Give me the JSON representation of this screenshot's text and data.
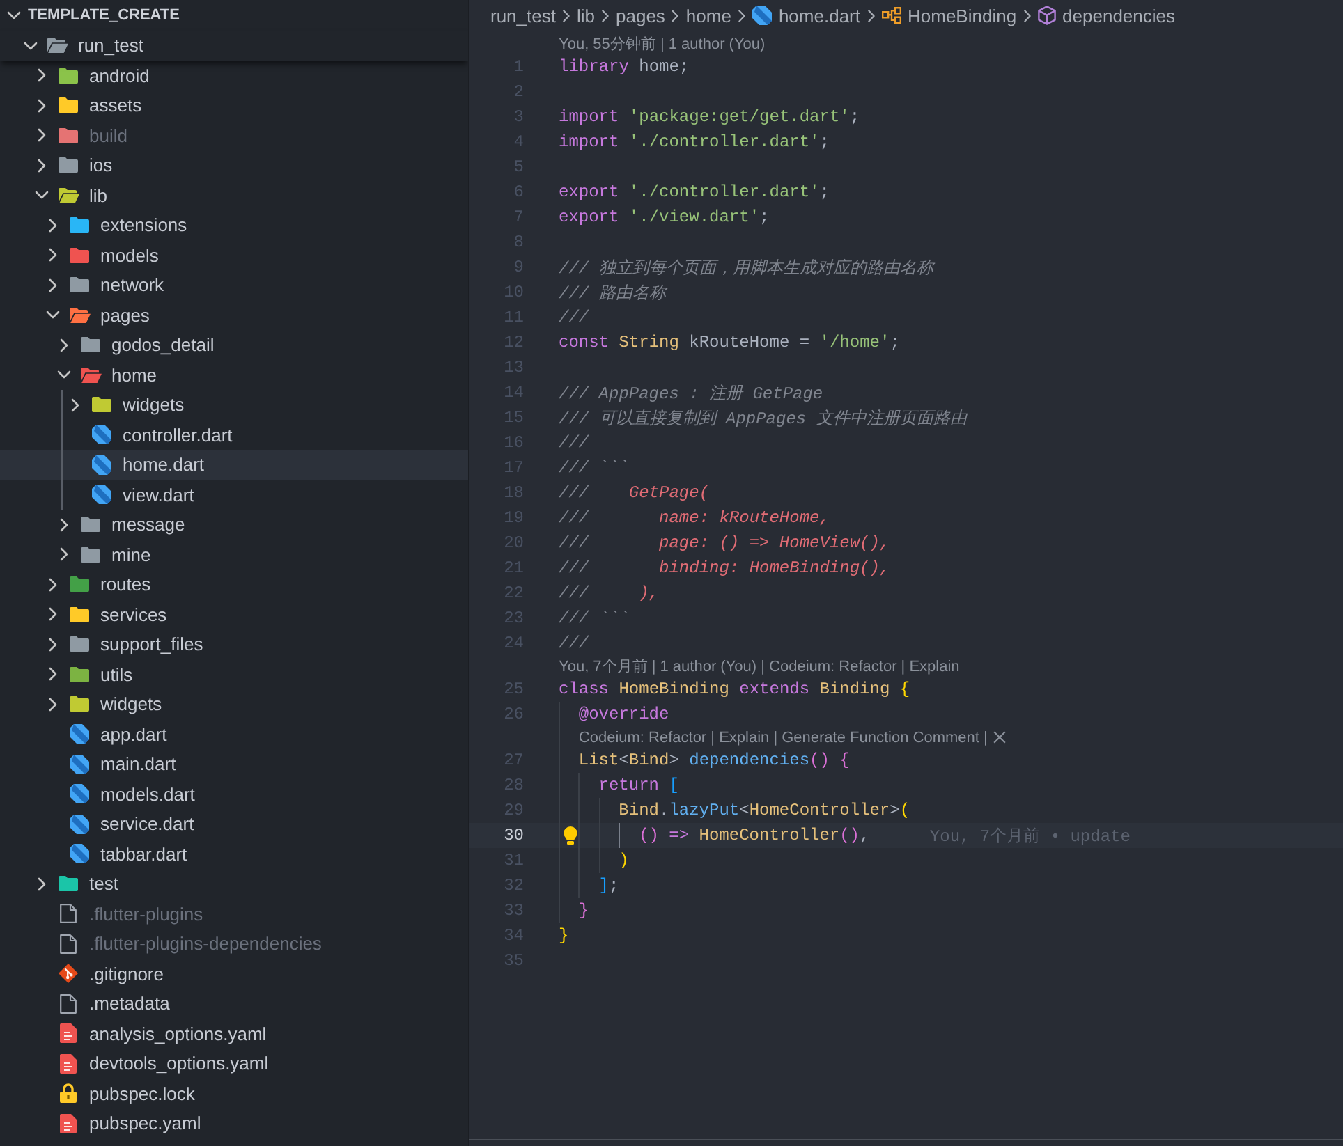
{
  "explorer": {
    "header": {
      "label": "TEMPLATE_CREATE",
      "expanded": true
    },
    "tree": [
      {
        "label": "run_test",
        "kind": "folder",
        "color": "#8f9aa3",
        "expanded": true,
        "selected": false,
        "ignored": false,
        "children": [
          {
            "label": "android",
            "kind": "folder",
            "color": "#8bc34a",
            "expanded": false,
            "selected": false,
            "ignored": false
          },
          {
            "label": "assets",
            "kind": "folder",
            "color": "#ffca28",
            "expanded": false,
            "selected": false,
            "ignored": false
          },
          {
            "label": "build",
            "kind": "folder",
            "color": "#e57373",
            "expanded": false,
            "selected": false,
            "ignored": true
          },
          {
            "label": "ios",
            "kind": "folder",
            "color": "#8f9aa3",
            "expanded": false,
            "selected": false,
            "ignored": false
          },
          {
            "label": "lib",
            "kind": "folder",
            "color": "#c0ca33",
            "expanded": true,
            "selected": false,
            "ignored": false,
            "children": [
              {
                "label": "extensions",
                "kind": "folder",
                "color": "#29b6f6",
                "expanded": false,
                "selected": false,
                "ignored": false
              },
              {
                "label": "models",
                "kind": "folder",
                "color": "#ef5350",
                "expanded": false,
                "selected": false,
                "ignored": false
              },
              {
                "label": "network",
                "kind": "folder",
                "color": "#8f9aa3",
                "expanded": false,
                "selected": false,
                "ignored": false
              },
              {
                "label": "pages",
                "kind": "folder",
                "color": "#ff7043",
                "expanded": true,
                "selected": false,
                "ignored": false,
                "children": [
                  {
                    "label": "godos_detail",
                    "kind": "folder",
                    "color": "#8f9aa3",
                    "expanded": false,
                    "selected": false,
                    "ignored": false
                  },
                  {
                    "label": "home",
                    "kind": "folder",
                    "color": "#ef5350",
                    "expanded": true,
                    "selected": false,
                    "ignored": false,
                    "children": [
                      {
                        "label": "widgets",
                        "kind": "folder",
                        "color": "#c0ca33",
                        "expanded": false,
                        "selected": false,
                        "ignored": false
                      },
                      {
                        "label": "controller.dart",
                        "kind": "dart",
                        "selected": false,
                        "ignored": false
                      },
                      {
                        "label": "home.dart",
                        "kind": "dart",
                        "selected": true,
                        "ignored": false
                      },
                      {
                        "label": "view.dart",
                        "kind": "dart",
                        "selected": false,
                        "ignored": false
                      }
                    ]
                  },
                  {
                    "label": "message",
                    "kind": "folder",
                    "color": "#8f9aa3",
                    "expanded": false,
                    "selected": false,
                    "ignored": false
                  },
                  {
                    "label": "mine",
                    "kind": "folder",
                    "color": "#8f9aa3",
                    "expanded": false,
                    "selected": false,
                    "ignored": false
                  }
                ]
              },
              {
                "label": "routes",
                "kind": "folder",
                "color": "#43a047",
                "expanded": false,
                "selected": false,
                "ignored": false
              },
              {
                "label": "services",
                "kind": "folder",
                "color": "#ffca28",
                "expanded": false,
                "selected": false,
                "ignored": false
              },
              {
                "label": "support_files",
                "kind": "folder",
                "color": "#8f9aa3",
                "expanded": false,
                "selected": false,
                "ignored": false
              },
              {
                "label": "utils",
                "kind": "folder",
                "color": "#7cb342",
                "expanded": false,
                "selected": false,
                "ignored": false
              },
              {
                "label": "widgets",
                "kind": "folder",
                "color": "#c0ca33",
                "expanded": false,
                "selected": false,
                "ignored": false
              },
              {
                "label": "app.dart",
                "kind": "dart",
                "selected": false,
                "ignored": false
              },
              {
                "label": "main.dart",
                "kind": "dart",
                "selected": false,
                "ignored": false
              },
              {
                "label": "models.dart",
                "kind": "dart",
                "selected": false,
                "ignored": false
              },
              {
                "label": "service.dart",
                "kind": "dart",
                "selected": false,
                "ignored": false
              },
              {
                "label": "tabbar.dart",
                "kind": "dart",
                "selected": false,
                "ignored": false
              }
            ]
          },
          {
            "label": "test",
            "kind": "folder",
            "color": "#1bc5a8",
            "expanded": false,
            "selected": false,
            "ignored": false
          },
          {
            "label": ".flutter-plugins",
            "kind": "plain",
            "selected": false,
            "ignored": true
          },
          {
            "label": ".flutter-plugins-dependencies",
            "kind": "plain",
            "selected": false,
            "ignored": true
          },
          {
            "label": ".gitignore",
            "kind": "git",
            "selected": false,
            "ignored": false
          },
          {
            "label": ".metadata",
            "kind": "plain",
            "selected": false,
            "ignored": false
          },
          {
            "label": "analysis_options.yaml",
            "kind": "yaml",
            "selected": false,
            "ignored": false
          },
          {
            "label": "devtools_options.yaml",
            "kind": "yaml",
            "selected": false,
            "ignored": false
          },
          {
            "label": "pubspec.lock",
            "kind": "lock",
            "selected": false,
            "ignored": false
          },
          {
            "label": "pubspec.yaml",
            "kind": "yaml",
            "selected": false,
            "ignored": false
          }
        ]
      }
    ]
  },
  "editor": {
    "breadcrumbs": [
      {
        "label": "run_test",
        "kind": "folder"
      },
      {
        "label": "lib",
        "kind": "folder"
      },
      {
        "label": "pages",
        "kind": "folder"
      },
      {
        "label": "home",
        "kind": "folder"
      },
      {
        "label": "home.dart",
        "kind": "dart"
      },
      {
        "label": "HomeBinding",
        "kind": "class"
      },
      {
        "label": "dependencies",
        "kind": "method"
      }
    ],
    "lines": [
      {
        "number": "1",
        "current": false,
        "codelens": {
          "text": "You, 55分钟前 | 1 author (You)",
          "closable": false
        },
        "tokens": [
          {
            "kind": "keyword",
            "text": "library"
          },
          {
            "kind": "plain",
            "text": " home;"
          }
        ]
      },
      {
        "number": "2",
        "current": false
      },
      {
        "number": "3",
        "current": false,
        "tokens": [
          {
            "kind": "keyword",
            "text": "import "
          },
          {
            "kind": "string",
            "text": "'package:get/get.dart'"
          },
          {
            "kind": "plain",
            "text": ";"
          }
        ]
      },
      {
        "number": "4",
        "current": false,
        "tokens": [
          {
            "kind": "keyword",
            "text": "import "
          },
          {
            "kind": "string",
            "text": "'./controller.dart'"
          },
          {
            "kind": "plain",
            "text": ";"
          }
        ]
      },
      {
        "number": "5",
        "current": false
      },
      {
        "number": "6",
        "current": false,
        "tokens": [
          {
            "kind": "keyword",
            "text": "export "
          },
          {
            "kind": "string",
            "text": "'./controller.dart'"
          },
          {
            "kind": "plain",
            "text": ";"
          }
        ]
      },
      {
        "number": "7",
        "current": false,
        "tokens": [
          {
            "kind": "keyword",
            "text": "export "
          },
          {
            "kind": "string",
            "text": "'./view.dart'"
          },
          {
            "kind": "plain",
            "text": ";"
          }
        ]
      },
      {
        "number": "8",
        "current": false
      },
      {
        "number": "9",
        "current": false,
        "tokens": [
          {
            "kind": "comment",
            "text": "/// 独立到每个页面，用脚本生成对应的路由名称"
          }
        ]
      },
      {
        "number": "10",
        "current": false,
        "tokens": [
          {
            "kind": "comment",
            "text": "/// 路由名称"
          }
        ]
      },
      {
        "number": "11",
        "current": false,
        "tokens": [
          {
            "kind": "comment",
            "text": "///"
          }
        ]
      },
      {
        "number": "12",
        "current": false,
        "tokens": [
          {
            "kind": "keyword",
            "text": "const "
          },
          {
            "kind": "type",
            "text": "String"
          },
          {
            "kind": "plain",
            "text": " kRouteHome = "
          },
          {
            "kind": "string",
            "text": "'/home'"
          },
          {
            "kind": "plain",
            "text": ";"
          }
        ]
      },
      {
        "number": "13",
        "current": false
      },
      {
        "number": "14",
        "current": false,
        "tokens": [
          {
            "kind": "comment",
            "text": "/// AppPages : 注册 GetPage"
          }
        ]
      },
      {
        "number": "15",
        "current": false,
        "tokens": [
          {
            "kind": "comment",
            "text": "/// 可以直接复制到 AppPages 文件中注册页面路由"
          }
        ]
      },
      {
        "number": "16",
        "current": false,
        "tokens": [
          {
            "kind": "comment",
            "text": "///"
          }
        ]
      },
      {
        "number": "17",
        "current": false,
        "tokens": [
          {
            "kind": "comment",
            "text": "/// ```"
          }
        ]
      },
      {
        "number": "18",
        "current": false,
        "tokens": [
          {
            "kind": "comment",
            "text": "///    "
          },
          {
            "kind": "doc-code",
            "text": "GetPage("
          }
        ]
      },
      {
        "number": "19",
        "current": false,
        "tokens": [
          {
            "kind": "comment",
            "text": "///       "
          },
          {
            "kind": "doc-code",
            "text": "name: kRouteHome,"
          }
        ]
      },
      {
        "number": "20",
        "current": false,
        "tokens": [
          {
            "kind": "comment",
            "text": "///       "
          },
          {
            "kind": "doc-code",
            "text": "page: () => HomeView(),"
          }
        ]
      },
      {
        "number": "21",
        "current": false,
        "tokens": [
          {
            "kind": "comment",
            "text": "///       "
          },
          {
            "kind": "doc-code",
            "text": "binding: HomeBinding(),"
          }
        ]
      },
      {
        "number": "22",
        "current": false,
        "tokens": [
          {
            "kind": "comment",
            "text": "///     "
          },
          {
            "kind": "doc-code",
            "text": "),"
          }
        ]
      },
      {
        "number": "23",
        "current": false,
        "tokens": [
          {
            "kind": "comment",
            "text": "/// ```"
          }
        ]
      },
      {
        "number": "24",
        "current": false,
        "tokens": [
          {
            "kind": "comment",
            "text": "///"
          }
        ]
      },
      {
        "number": "25",
        "current": false,
        "codelens": {
          "text": "You, 7个月前 | 1 author (You) | Codeium: Refactor | Explain",
          "closable": false
        },
        "tokens": [
          {
            "kind": "keyword",
            "text": "class "
          },
          {
            "kind": "type",
            "text": "HomeBinding "
          },
          {
            "kind": "keyword",
            "text": "extends "
          },
          {
            "kind": "type",
            "text": "Binding "
          },
          {
            "kind": "bracket1",
            "text": "{"
          }
        ]
      },
      {
        "number": "26",
        "current": false,
        "tokens": [
          {
            "kind": "annotation",
            "text": "  @override"
          }
        ]
      },
      {
        "number": "27",
        "current": false,
        "codelens": {
          "text": "Codeium: Refactor | Explain | Generate Function Comment |",
          "closable": true
        },
        "tokens": [
          {
            "kind": "type",
            "text": "  List"
          },
          {
            "kind": "plain",
            "text": "<"
          },
          {
            "kind": "type",
            "text": "Bind"
          },
          {
            "kind": "plain",
            "text": "> "
          },
          {
            "kind": "function",
            "text": "dependencies"
          },
          {
            "kind": "bracket2",
            "text": "() {"
          }
        ]
      },
      {
        "number": "28",
        "current": false,
        "tokens": [
          {
            "kind": "keyword",
            "text": "    return "
          },
          {
            "kind": "bracket3",
            "text": "["
          }
        ]
      },
      {
        "number": "29",
        "current": false,
        "tokens": [
          {
            "kind": "type",
            "text": "      Bind"
          },
          {
            "kind": "plain",
            "text": "."
          },
          {
            "kind": "function",
            "text": "lazyPut"
          },
          {
            "kind": "plain",
            "text": "<"
          },
          {
            "kind": "type",
            "text": "HomeController"
          },
          {
            "kind": "plain",
            "text": ">"
          },
          {
            "kind": "bracket1",
            "text": "("
          }
        ]
      },
      {
        "number": "30",
        "current": true,
        "lightbulb": true,
        "blame": "You, 7个月前 • update",
        "tokens": [
          {
            "kind": "bracket2",
            "text": "        () "
          },
          {
            "kind": "keyword",
            "text": "=> "
          },
          {
            "kind": "type",
            "text": "HomeController"
          },
          {
            "kind": "bracket2",
            "text": "()"
          },
          {
            "kind": "plain",
            "text": ","
          }
        ]
      },
      {
        "number": "31",
        "current": false,
        "tokens": [
          {
            "kind": "bracket1",
            "text": "      )"
          }
        ]
      },
      {
        "number": "32",
        "current": false,
        "tokens": [
          {
            "kind": "bracket3",
            "text": "    ]"
          },
          {
            "kind": "plain",
            "text": ";"
          }
        ]
      },
      {
        "number": "33",
        "current": false,
        "tokens": [
          {
            "kind": "bracket2",
            "text": "  }"
          }
        ]
      },
      {
        "number": "34",
        "current": false,
        "tokens": [
          {
            "kind": "bracket1",
            "text": "}"
          }
        ]
      },
      {
        "number": "35",
        "current": false
      }
    ]
  }
}
